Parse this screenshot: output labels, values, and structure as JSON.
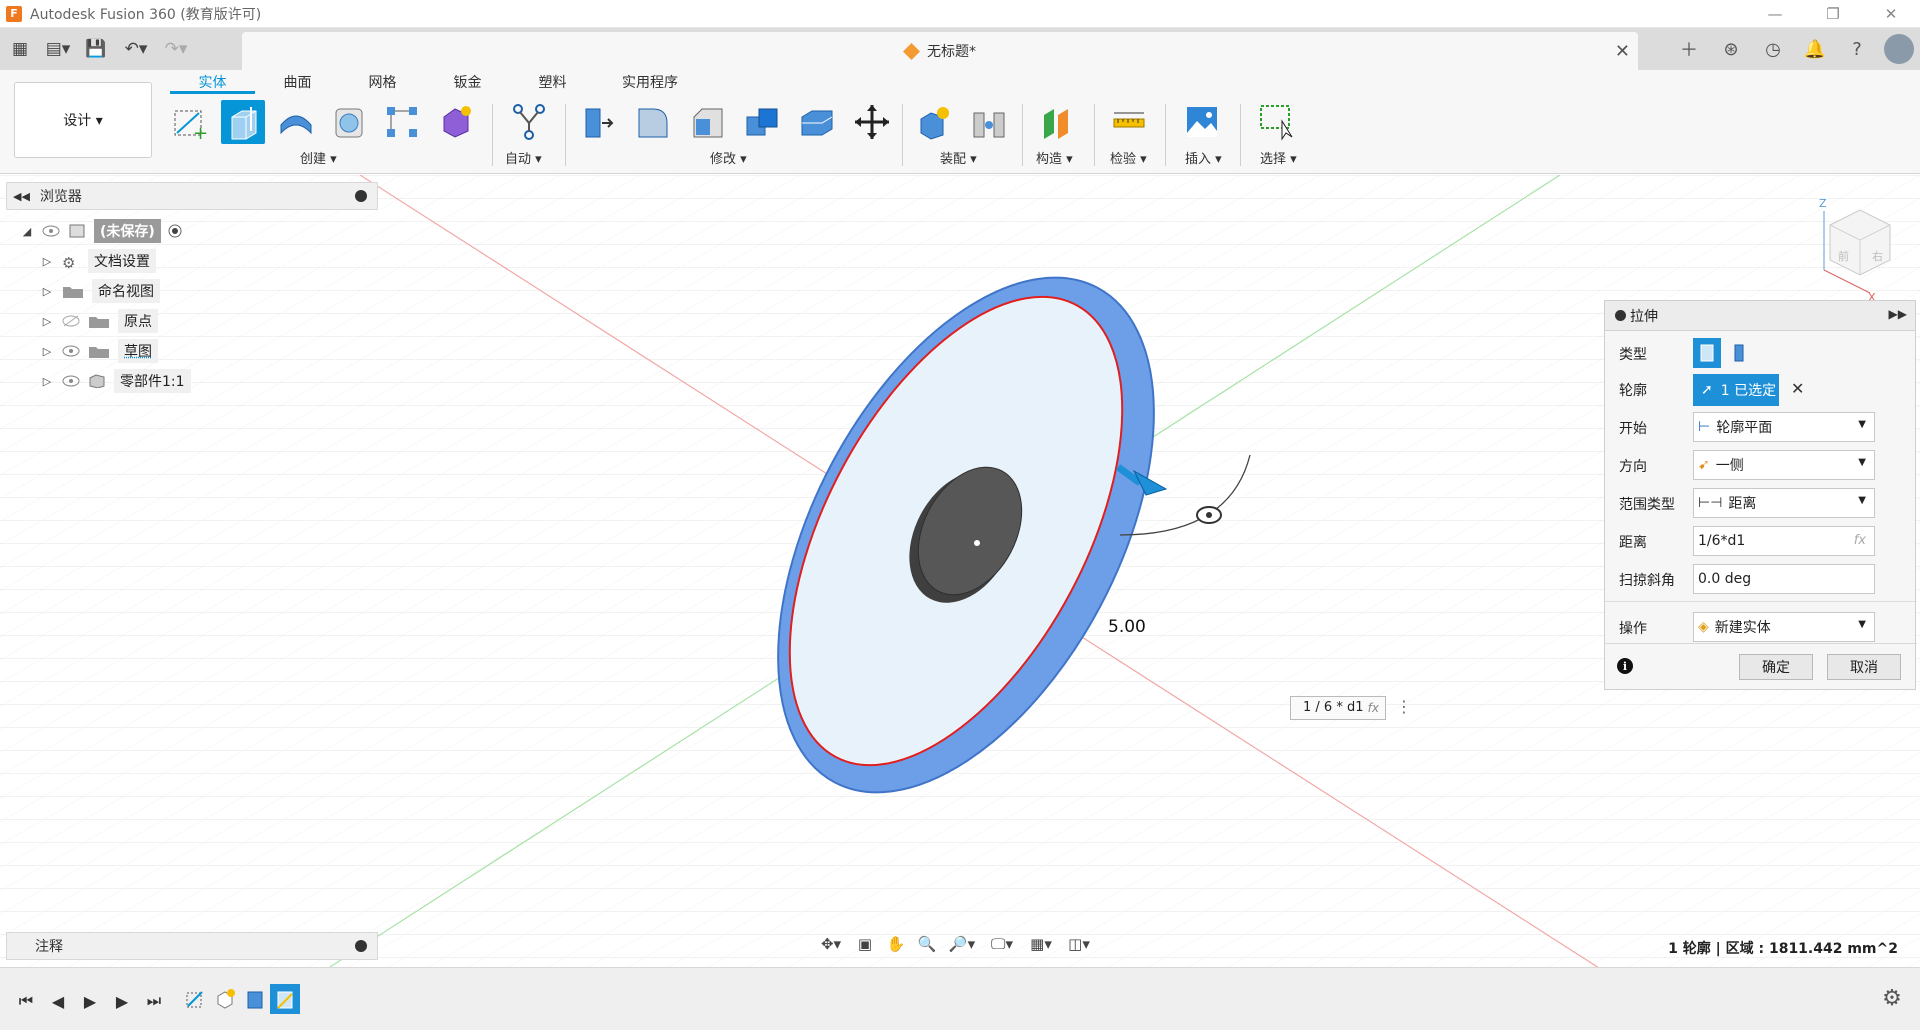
{
  "window": {
    "title": "Autodesk Fusion 360 (教育版许可)"
  },
  "doc_tab": {
    "title": "无标题*"
  },
  "workspace": {
    "label": "设计 ▾"
  },
  "ribbon": {
    "tabs": [
      {
        "label": "实体",
        "active": true
      },
      {
        "label": "曲面"
      },
      {
        "label": "网格"
      },
      {
        "label": "钣金"
      },
      {
        "label": "塑料"
      },
      {
        "label": "实用程序"
      }
    ],
    "groups": {
      "create": "创建 ▾",
      "automate": "自动 ▾",
      "modify": "修改 ▾",
      "assemble": "装配 ▾",
      "construct": "构造 ▾",
      "inspect": "检验 ▾",
      "insert": "插入 ▾",
      "select": "选择 ▾"
    }
  },
  "browser": {
    "title": "浏览器",
    "items": [
      {
        "label": "(未保存)"
      },
      {
        "label": "文档设置"
      },
      {
        "label": "命名视图"
      },
      {
        "label": "原点"
      },
      {
        "label": "草图"
      },
      {
        "label": "零部件1:1"
      }
    ]
  },
  "notes": {
    "title": "注释"
  },
  "viewport": {
    "dimension_label": "5.00",
    "dimension_input": "1 / 6 * d1",
    "fx": "fx"
  },
  "extrude_dialog": {
    "title": "拉伸",
    "rows": {
      "type": "类型",
      "profile": "轮廓",
      "profile_value": "1 已选定",
      "start": "开始",
      "start_value": "轮廓平面",
      "direction": "方向",
      "direction_value": "一侧",
      "extent_type": "范围类型",
      "extent_value": "距离",
      "distance": "距离",
      "distance_value": "1/6*d1",
      "taper": "扫掠斜角",
      "taper_value": "0.0 deg",
      "operation": "操作",
      "operation_value": "新建实体"
    },
    "ok": "确定",
    "cancel": "取消"
  },
  "status": {
    "text": "1 轮廓 | 区域 : 1811.442 mm^2"
  },
  "colors": {
    "accent": "#0696d7",
    "extrude_blue": "#4a86e8",
    "profile_red": "#e02020"
  }
}
